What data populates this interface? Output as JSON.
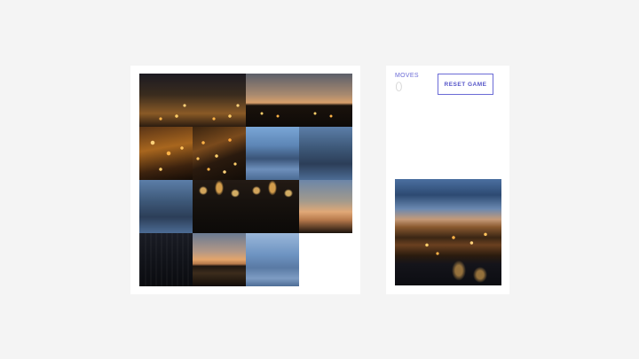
{
  "game": {
    "moves_label": "MOVES",
    "moves_value": "0",
    "reset_label": "RESET GAME"
  },
  "board": {
    "grid": "4x4",
    "tiles": [
      {
        "row": 0,
        "col": 0,
        "art": "city-top",
        "name": "puzzle-tile"
      },
      {
        "row": 0,
        "col": 1,
        "art": "city-top",
        "name": "puzzle-tile"
      },
      {
        "row": 0,
        "col": 2,
        "art": "dusk-skyline",
        "name": "puzzle-tile"
      },
      {
        "row": 0,
        "col": 3,
        "art": "dusk-skyline",
        "name": "puzzle-tile"
      },
      {
        "row": 1,
        "col": 0,
        "art": "city-mid",
        "name": "puzzle-tile"
      },
      {
        "row": 1,
        "col": 1,
        "art": "city-night",
        "name": "puzzle-tile"
      },
      {
        "row": 1,
        "col": 2,
        "art": "blue-clouds",
        "name": "puzzle-tile"
      },
      {
        "row": 1,
        "col": 3,
        "art": "blue-clouds-dark",
        "name": "puzzle-tile"
      },
      {
        "row": 2,
        "col": 0,
        "art": "blue-clouds-dark",
        "name": "puzzle-tile"
      },
      {
        "row": 2,
        "col": 1,
        "art": "river-lights",
        "name": "puzzle-tile"
      },
      {
        "row": 2,
        "col": 2,
        "art": "river-lights",
        "name": "puzzle-tile"
      },
      {
        "row": 2,
        "col": 3,
        "art": "horizon-warm",
        "name": "puzzle-tile"
      },
      {
        "row": 3,
        "col": 0,
        "art": "river-dark",
        "name": "puzzle-tile"
      },
      {
        "row": 3,
        "col": 1,
        "art": "dusk-bridge",
        "name": "puzzle-tile"
      },
      {
        "row": 3,
        "col": 2,
        "art": "blue-cloud-horizon",
        "name": "puzzle-tile"
      },
      {
        "row": 3,
        "col": 3,
        "art": "empty",
        "name": "empty-slot"
      }
    ]
  },
  "colors": {
    "accent": "#5454c8",
    "background": "#f4f4f4",
    "card": "#ffffff"
  }
}
